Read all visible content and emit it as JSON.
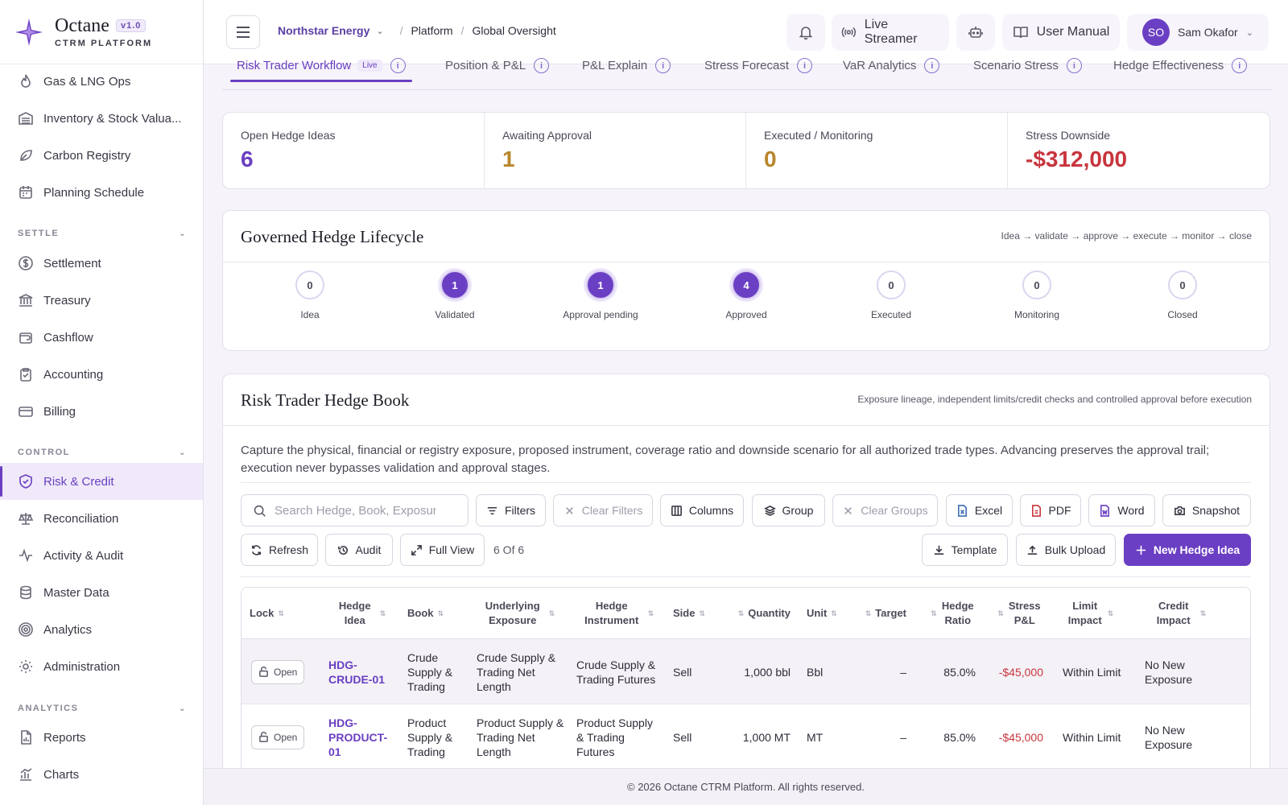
{
  "brand": {
    "name": "Octane",
    "version": "v1.0",
    "subtitle": "CTRM PLATFORM"
  },
  "sidebar": {
    "items_top": [
      {
        "label": "Gas & LNG Ops",
        "icon": "flame-icon"
      },
      {
        "label": "Inventory & Stock Valua...",
        "icon": "warehouse-icon"
      },
      {
        "label": "Carbon Registry",
        "icon": "leaf-icon"
      },
      {
        "label": "Planning Schedule",
        "icon": "calendar-icon"
      }
    ],
    "section_settle": "SETTLE",
    "items_settle": [
      {
        "label": "Settlement",
        "icon": "dollar-circle-icon"
      },
      {
        "label": "Treasury",
        "icon": "bank-icon"
      },
      {
        "label": "Cashflow",
        "icon": "wallet-icon"
      },
      {
        "label": "Accounting",
        "icon": "clipboard-icon"
      },
      {
        "label": "Billing",
        "icon": "credit-card-icon"
      }
    ],
    "section_control": "CONTROL",
    "items_control": [
      {
        "label": "Risk & Credit",
        "icon": "shield-check-icon",
        "active": true
      },
      {
        "label": "Reconciliation",
        "icon": "scale-icon"
      },
      {
        "label": "Activity & Audit",
        "icon": "activity-icon"
      },
      {
        "label": "Master Data",
        "icon": "database-icon"
      },
      {
        "label": "Analytics",
        "icon": "target-icon"
      },
      {
        "label": "Administration",
        "icon": "gear-icon"
      }
    ],
    "section_analytics": "ANALYTICS",
    "items_analytics": [
      {
        "label": "Reports",
        "icon": "file-chart-icon"
      },
      {
        "label": "Charts",
        "icon": "bar-chart-icon"
      }
    ]
  },
  "header": {
    "org": "Northstar Energy",
    "crumb1": "Platform",
    "crumb2": "Global Oversight",
    "live_streamer": "Live Streamer",
    "user_manual": "User Manual",
    "user_initials": "SO",
    "user_name": "Sam Okafor"
  },
  "tabs": [
    {
      "label": "Risk Trader Workflow",
      "badge": "Live",
      "active": true
    },
    {
      "label": "Position & P&L"
    },
    {
      "label": "P&L Explain"
    },
    {
      "label": "Stress Forecast"
    },
    {
      "label": "VaR Analytics"
    },
    {
      "label": "Scenario Stress"
    },
    {
      "label": "Hedge Effectiveness"
    }
  ],
  "kpis": [
    {
      "label": "Open Hedge Ideas",
      "value": "6",
      "color": "#6a3fc1"
    },
    {
      "label": "Awaiting Approval",
      "value": "1",
      "color": "#b8862b"
    },
    {
      "label": "Executed / Monitoring",
      "value": "0",
      "color": "#b8862b"
    },
    {
      "label": "Stress Downside",
      "value": "-$312,000",
      "color": "#c8353d"
    }
  ],
  "lifecycle": {
    "title": "Governed Hedge Lifecycle",
    "subtitle": "Idea → validate → approve → execute → monitor → close",
    "stages": [
      {
        "label": "Idea",
        "count": "0",
        "filled": false
      },
      {
        "label": "Validated",
        "count": "1",
        "filled": true
      },
      {
        "label": "Approval pending",
        "count": "1",
        "filled": true
      },
      {
        "label": "Approved",
        "count": "4",
        "filled": true
      },
      {
        "label": "Executed",
        "count": "0",
        "filled": false
      },
      {
        "label": "Monitoring",
        "count": "0",
        "filled": false
      },
      {
        "label": "Closed",
        "count": "0",
        "filled": false
      }
    ]
  },
  "hedge_book": {
    "title": "Risk Trader Hedge Book",
    "subtitle": "Exposure lineage, independent limits/credit checks and controlled approval before execution",
    "description": "Capture the physical, financial or registry exposure, proposed instrument, coverage ratio and downside scenario for all authorized trade types. Advancing preserves the approval trail; execution never bypasses validation and approval stages.",
    "search_placeholder": "Search Hedge, Book, Exposure",
    "buttons": {
      "filters": "Filters",
      "clear_filters": "Clear Filters",
      "columns": "Columns",
      "group": "Group",
      "clear_groups": "Clear Groups",
      "excel": "Excel",
      "pdf": "PDF",
      "word": "Word",
      "snapshot": "Snapshot",
      "refresh": "Refresh",
      "audit": "Audit",
      "full_view": "Full View",
      "count": "6 Of 6",
      "template": "Template",
      "bulk_upload": "Bulk Upload",
      "new_hedge": "New Hedge Idea"
    },
    "columns": [
      "Lock",
      "Hedge Idea",
      "Book",
      "Underlying Exposure",
      "Hedge Instrument",
      "Side",
      "Quantity",
      "Unit",
      "Target",
      "Hedge Ratio",
      "Stress P&L",
      "Limit Impact",
      "Credit Impact"
    ],
    "rows": [
      {
        "lock": "Open",
        "hedge": "HDG-CRUDE-01",
        "book": "Crude Supply & Trading",
        "exposure": "Crude Supply & Trading Net Length",
        "instrument": "Crude Supply & Trading Futures",
        "side": "Sell",
        "quantity": "1,000 bbl",
        "unit": "Bbl",
        "target": "–",
        "ratio": "85.0%",
        "stress": "-$45,000",
        "limit": "Within Limit",
        "credit": "No New Exposure"
      },
      {
        "lock": "Open",
        "hedge": "HDG-PRODUCT-01",
        "book": "Product Supply & Trading",
        "exposure": "Product Supply & Trading Net Length",
        "instrument": "Product Supply & Trading Futures",
        "side": "Sell",
        "quantity": "1,000 MT",
        "unit": "MT",
        "target": "–",
        "ratio": "85.0%",
        "stress": "-$45,000",
        "limit": "Within Limit",
        "credit": "No New Exposure"
      }
    ]
  },
  "footer": "© 2026 Octane CTRM Platform. All rights reserved."
}
